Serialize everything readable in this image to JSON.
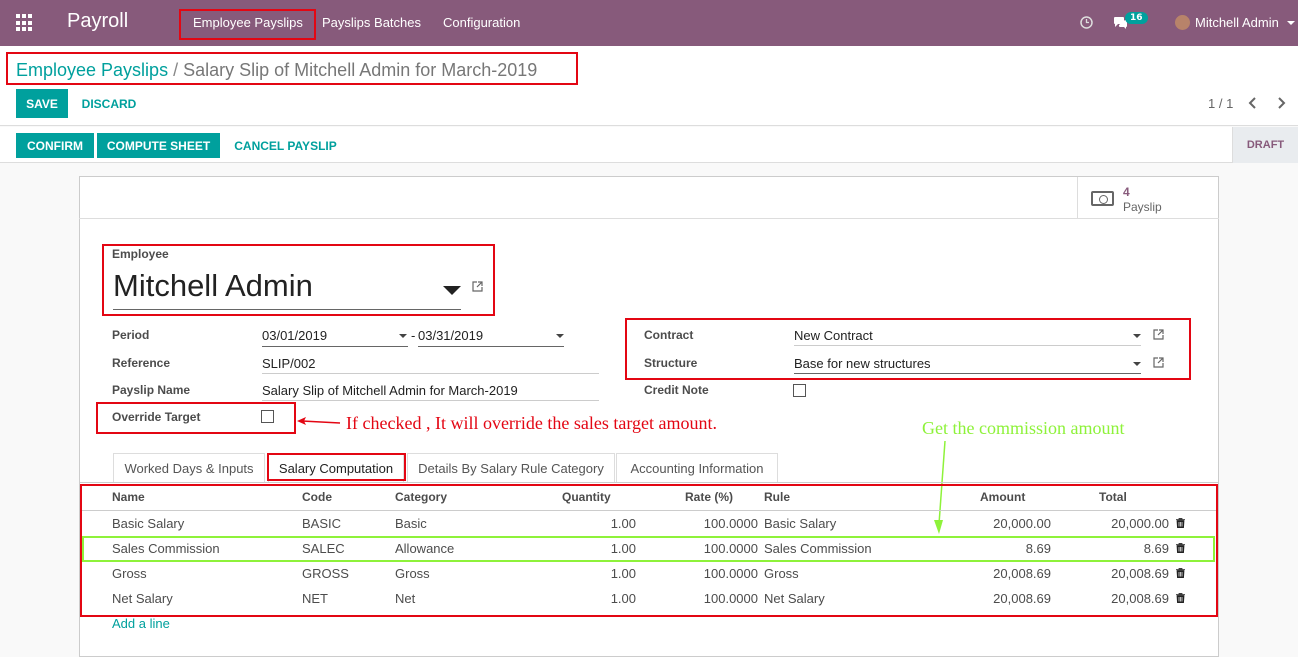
{
  "navbar": {
    "app_title": "Payroll",
    "menu": [
      "Employee Payslips",
      "Payslips Batches",
      "Configuration"
    ],
    "notification_count": "16",
    "user_name": "Mitchell Admin"
  },
  "breadcrumb": {
    "parent": "Employee Payslips",
    "separator": "/",
    "current": "Salary Slip of Mitchell Admin for March-2019"
  },
  "control": {
    "save_label": "SAVE",
    "discard_label": "DISCARD",
    "pager": "1 / 1"
  },
  "statusbar": {
    "confirm_label": "CONFIRM",
    "compute_label": "COMPUTE SHEET",
    "cancel_label": "CANCEL PAYSLIP",
    "state": "DRAFT"
  },
  "stat_button": {
    "value": "4",
    "label": "Payslip",
    "icon": "money-icon"
  },
  "form": {
    "employee_label": "Employee",
    "employee_name": "Mitchell Admin",
    "period_label": "Period",
    "date_from": "03/01/2019",
    "date_sep": "-",
    "date_to": "03/31/2019",
    "reference_label": "Reference",
    "reference": "SLIP/002",
    "payslip_name_label": "Payslip Name",
    "payslip_name": "Salary Slip of Mitchell Admin for March-2019",
    "override_target_label": "Override Target",
    "contract_label": "Contract",
    "contract": "New Contract",
    "structure_label": "Structure",
    "structure": "Base for new structures",
    "credit_note_label": "Credit Note"
  },
  "annotations": {
    "override_note": "If checked , It will override the sales target amount.",
    "commission_note": "Get the commission amount",
    "red": "#e30613",
    "green": "#8ef23a"
  },
  "tabs": [
    "Worked Days & Inputs",
    "Salary Computation",
    "Details By Salary Rule Category",
    "Accounting Information"
  ],
  "table": {
    "headers": [
      "Name",
      "Code",
      "Category",
      "Quantity",
      "Rate (%)",
      "Rule",
      "Amount",
      "Total"
    ],
    "rows": [
      [
        "Basic Salary",
        "BASIC",
        "Basic",
        "1.00",
        "100.0000",
        "Basic Salary",
        "20,000.00",
        "20,000.00"
      ],
      [
        "Sales Commission",
        "SALEC",
        "Allowance",
        "1.00",
        "100.0000",
        "Sales Commission",
        "8.69",
        "8.69"
      ],
      [
        "Gross",
        "GROSS",
        "Gross",
        "1.00",
        "100.0000",
        "Gross",
        "20,008.69",
        "20,008.69"
      ],
      [
        "Net Salary",
        "NET",
        "Net",
        "1.00",
        "100.0000",
        "Net Salary",
        "20,008.69",
        "20,008.69"
      ]
    ],
    "add_line": "Add a line"
  },
  "colors": {
    "brand": "#875a7b",
    "accent": "#00a09d"
  }
}
